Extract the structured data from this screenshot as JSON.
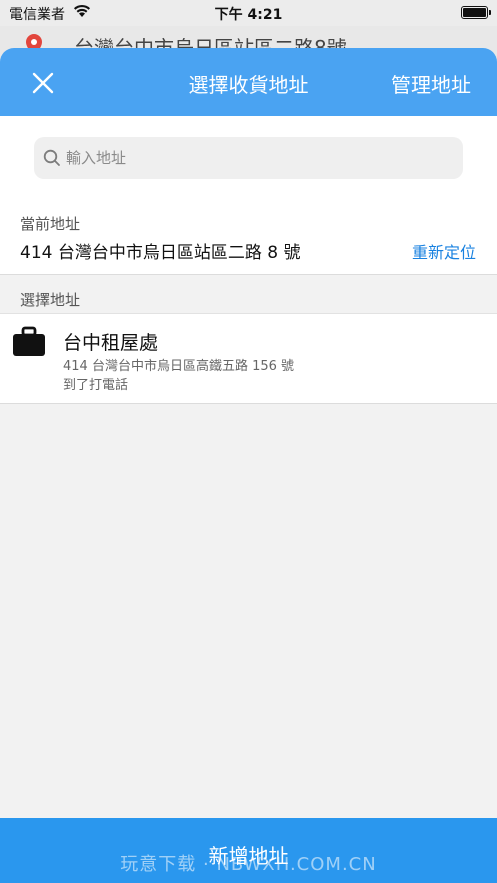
{
  "status_bar": {
    "carrier": "電信業者",
    "time": "下午 4:21"
  },
  "background": {
    "address_text": "台灣台中市烏日區站區二路8號"
  },
  "header": {
    "title": "選擇收貨地址",
    "manage_label": "管理地址"
  },
  "search": {
    "placeholder": "輸入地址"
  },
  "current": {
    "label": "當前地址",
    "address": "414 台灣台中市烏日區站區二路 8 號",
    "relocate_label": "重新定位"
  },
  "choose": {
    "label": "選擇地址",
    "items": [
      {
        "name": "台中租屋處",
        "address": "414 台灣台中市烏日區高鐵五路 156 號",
        "note": "到了打電話"
      }
    ]
  },
  "footer": {
    "add_label": "新增地址"
  },
  "watermark": "玩意下载 · NBWXH.COM.CN",
  "colors": {
    "header": "#4aa3f2",
    "button": "#2a97ee",
    "link": "#1a82e0"
  }
}
